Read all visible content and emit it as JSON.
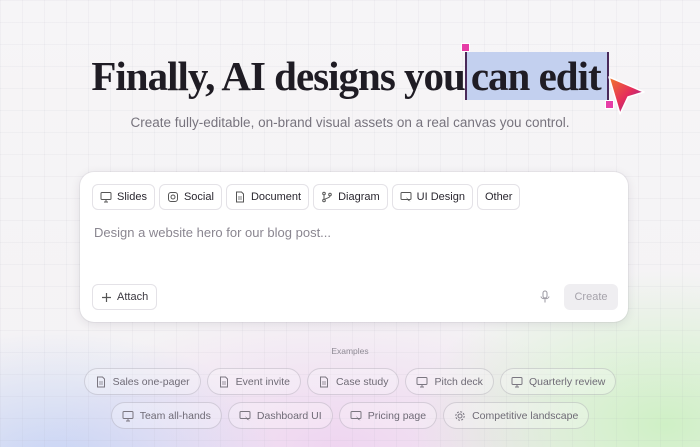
{
  "headline": {
    "lead": "Finally, AI designs you",
    "highlight": "can edit"
  },
  "subtitle": "Create fully-editable, on-brand visual assets on a real canvas you control.",
  "composer": {
    "categories": [
      {
        "label": "Slides",
        "icon": "presentation-icon"
      },
      {
        "label": "Social",
        "icon": "instagram-icon"
      },
      {
        "label": "Document",
        "icon": "document-icon"
      },
      {
        "label": "Diagram",
        "icon": "branch-icon"
      },
      {
        "label": "UI Design",
        "icon": "ui-design-icon"
      },
      {
        "label": "Other",
        "icon": ""
      }
    ],
    "placeholder": "Design a website hero for our blog post...",
    "attach_label": "Attach",
    "create_label": "Create"
  },
  "examples": {
    "label": "Examples",
    "row1": [
      {
        "label": "Sales one-pager",
        "icon": "document-icon"
      },
      {
        "label": "Event invite",
        "icon": "document-icon"
      },
      {
        "label": "Case study",
        "icon": "document-icon"
      },
      {
        "label": "Pitch deck",
        "icon": "presentation-icon"
      },
      {
        "label": "Quarterly review",
        "icon": "presentation-icon"
      }
    ],
    "row2": [
      {
        "label": "Team all-hands",
        "icon": "presentation-icon"
      },
      {
        "label": "Dashboard UI",
        "icon": "ui-design-icon"
      },
      {
        "label": "Pricing page",
        "icon": "ui-design-icon"
      },
      {
        "label": "Competitive landscape",
        "icon": "gear-icon"
      }
    ]
  },
  "colors": {
    "selection": "#c3d0ef",
    "handle": "#e63da6",
    "cursor_gradient": [
      "#6a1fb0",
      "#e52d5c",
      "#f07a2a"
    ]
  }
}
